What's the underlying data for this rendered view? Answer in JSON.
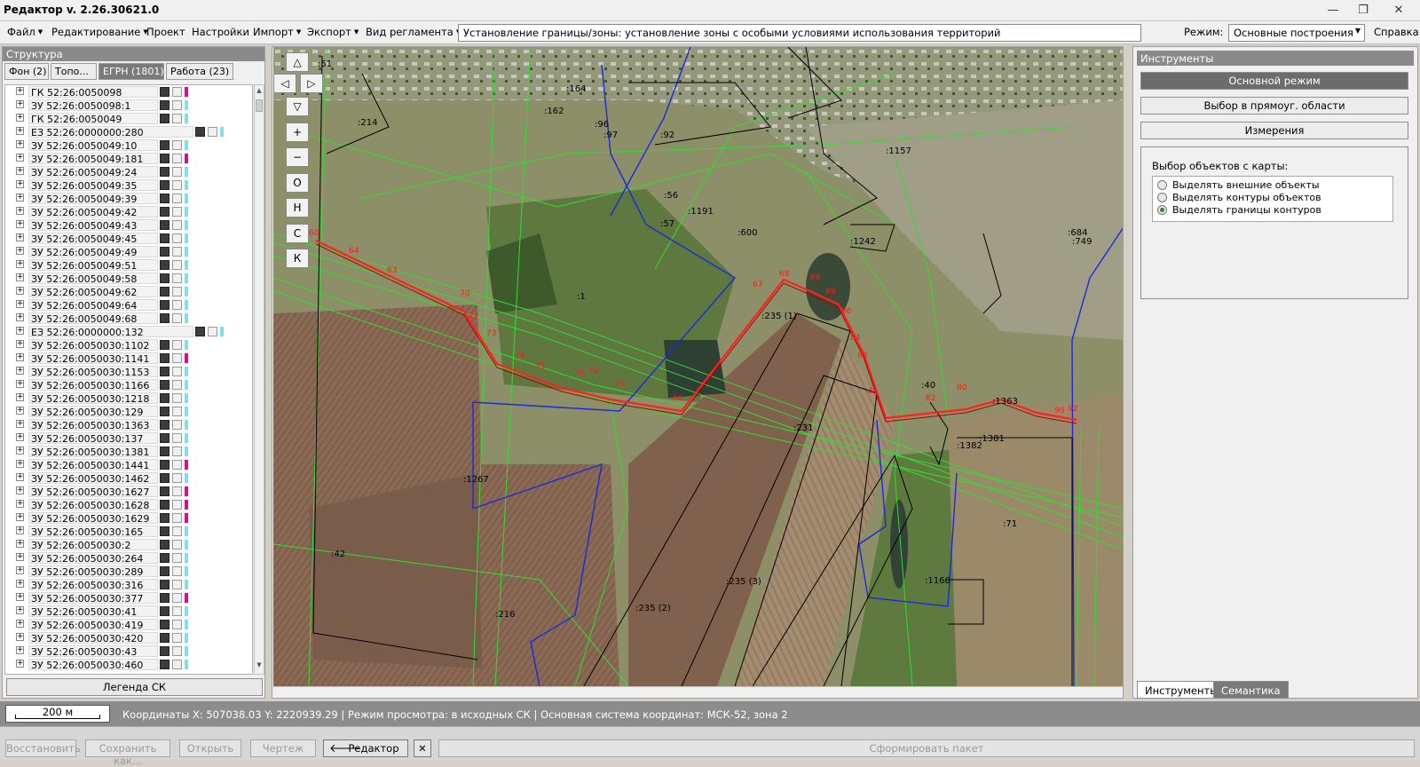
{
  "window": {
    "title": "Редактор v. 2.26.30621.0",
    "minimize": "—",
    "restore": "❐",
    "close": "✕"
  },
  "menu": {
    "file": "Файл",
    "edit": "Редактирование",
    "project": "Проект",
    "settings": "Настройки",
    "import": "Импорт",
    "export": "Экспорт",
    "reg_type": "Вид регламента",
    "regulation": "Установление границы/зоны: установление зоны с особыми условиями использования территорий",
    "mode_label": "Режим:",
    "mode_value": "Основные построения",
    "help": "Справка"
  },
  "structure": {
    "title": "Структура",
    "tabs": [
      "Фон (2)",
      "Топо...",
      "ЕГРН (1801)",
      "Работа (23)"
    ],
    "items": [
      {
        "label": "ГК 52:26:0050098",
        "flag": "#c8168a"
      },
      {
        "label": "ЗУ 52:26:0050098:1",
        "flag": "#7fe0e6"
      },
      {
        "label": "ГК 52:26:0050049",
        "flag": "#7fe0e6"
      },
      {
        "label": "ЕЗ 52:26:0000000:280",
        "flag": "#7fe0e6"
      },
      {
        "label": "ЗУ 52:26:0050049:10",
        "flag": "#7fe0e6"
      },
      {
        "label": "ЗУ 52:26:0050049:181",
        "flag": "#c8168a"
      },
      {
        "label": "ЗУ 52:26:0050049:24",
        "flag": "#7fe0e6"
      },
      {
        "label": "ЗУ 52:26:0050049:35",
        "flag": "#7fe0e6"
      },
      {
        "label": "ЗУ 52:26:0050049:39",
        "flag": "#7fe0e6"
      },
      {
        "label": "ЗУ 52:26:0050049:42",
        "flag": "#7fe0e6"
      },
      {
        "label": "ЗУ 52:26:0050049:43",
        "flag": "#7fe0e6"
      },
      {
        "label": "ЗУ 52:26:0050049:45",
        "flag": "#7fe0e6"
      },
      {
        "label": "ЗУ 52:26:0050049:49",
        "flag": "#7fe0e6"
      },
      {
        "label": "ЗУ 52:26:0050049:51",
        "flag": "#7fe0e6"
      },
      {
        "label": "ЗУ 52:26:0050049:58",
        "flag": "#7fe0e6"
      },
      {
        "label": "ЗУ 52:26:0050049:62",
        "flag": "#7fe0e6"
      },
      {
        "label": "ЗУ 52:26:0050049:64",
        "flag": "#7fe0e6"
      },
      {
        "label": "ЗУ 52:26:0050049:68",
        "flag": "#7fe0e6"
      },
      {
        "label": "ЕЗ 52:26:0000000:132",
        "flag": "#7fe0e6"
      },
      {
        "label": "ЗУ 52:26:0050030:1102",
        "flag": "#7fe0e6"
      },
      {
        "label": "ЗУ 52:26:0050030:1141",
        "flag": "#c8168a"
      },
      {
        "label": "ЗУ 52:26:0050030:1153",
        "flag": "#7fe0e6"
      },
      {
        "label": "ЗУ 52:26:0050030:1166",
        "flag": "#7fe0e6"
      },
      {
        "label": "ЗУ 52:26:0050030:1218",
        "flag": "#7fe0e6"
      },
      {
        "label": "ЗУ 52:26:0050030:129",
        "flag": "#7fe0e6"
      },
      {
        "label": "ЗУ 52:26:0050030:1363",
        "flag": "#7fe0e6"
      },
      {
        "label": "ЗУ 52:26:0050030:137",
        "flag": "#7fe0e6"
      },
      {
        "label": "ЗУ 52:26:0050030:1381",
        "flag": "#7fe0e6"
      },
      {
        "label": "ЗУ 52:26:0050030:1441",
        "flag": "#c8168a"
      },
      {
        "label": "ЗУ 52:26:0050030:1462",
        "flag": "#7fe0e6"
      },
      {
        "label": "ЗУ 52:26:0050030:1627",
        "flag": "#c8168a"
      },
      {
        "label": "ЗУ 52:26:0050030:1628",
        "flag": "#c8168a"
      },
      {
        "label": "ЗУ 52:26:0050030:1629",
        "flag": "#c8168a"
      },
      {
        "label": "ЗУ 52:26:0050030:165",
        "flag": "#7fe0e6"
      },
      {
        "label": "ЗУ 52:26:0050030:2",
        "flag": "#7fe0e6"
      },
      {
        "label": "ЗУ 52:26:0050030:264",
        "flag": "#7fe0e6"
      },
      {
        "label": "ЗУ 52:26:0050030:289",
        "flag": "#7fe0e6"
      },
      {
        "label": "ЗУ 52:26:0050030:316",
        "flag": "#7fe0e6"
      },
      {
        "label": "ЗУ 52:26:0050030:377",
        "flag": "#c8168a"
      },
      {
        "label": "ЗУ 52:26:0050030:41",
        "flag": "#7fe0e6"
      },
      {
        "label": "ЗУ 52:26:0050030:419",
        "flag": "#7fe0e6"
      },
      {
        "label": "ЗУ 52:26:0050030:420",
        "flag": "#7fe0e6"
      },
      {
        "label": "ЗУ 52:26:0050030:43",
        "flag": "#7fe0e6"
      },
      {
        "label": "ЗУ 52:26:0050030:460",
        "flag": "#7fe0e6"
      }
    ],
    "legend_button": "Легенда СК"
  },
  "map": {
    "nav": [
      "△",
      "◁",
      "▷",
      "▽",
      "+",
      "−",
      "О",
      "Н",
      "С",
      "К"
    ],
    "labels": [
      ":51",
      ":214",
      ":164",
      ":162",
      ":96",
      ":97",
      ":92",
      ":56",
      ":57",
      ":1191",
      ":600",
      ":1242",
      ":1",
      ":235 (1)",
      ":231",
      ":1267",
      ":42",
      ":216",
      ":235 (2)",
      ":235 (3)",
      ":1166",
      ":71",
      ":1382",
      ":1381",
      ":1363",
      ":1157",
      ":749",
      ":684",
      ":40"
    ],
    "points": [
      "60",
      "64",
      "63",
      "70",
      "72",
      "73",
      "78",
      "75",
      "76",
      "74",
      "79",
      "66",
      "67",
      "68",
      "69",
      "89",
      "86",
      "84",
      "83",
      "81",
      "82",
      "80",
      "90",
      "92"
    ]
  },
  "tools": {
    "title": "Инструменты",
    "main_mode": "Основной режим",
    "rect_select": "Выбор в прямоуг. области",
    "measure": "Измерения",
    "select_caption": "Выбор объектов с карты:",
    "options": [
      "Выделять внешние объекты",
      "Выделять контуры объектов",
      "Выделять границы контуров"
    ],
    "selected_option": 2,
    "tab_tools": "Инструменты",
    "tab_semantics": "Семантика"
  },
  "status": {
    "scale": "200 м",
    "coords": "Координаты  X: 507038.03 Y: 2220939.29 | Режим просмотра: в исходных СК | Основная система координат: МСК-52, зона 2"
  },
  "actions": {
    "restore": "Восстановить",
    "save_as": "Сохранить как...",
    "open": "Открыть",
    "drawing": "Чертеж",
    "back_arrow": "🡐",
    "editor": "Редактор",
    "close_x": "✕",
    "form_package": "Сформировать пакет"
  },
  "colors": {
    "boundary_red": "#e01010",
    "zone_green": "#2ee02e",
    "parcel_blue": "#1a2adc",
    "parcel_black": "#000000"
  }
}
